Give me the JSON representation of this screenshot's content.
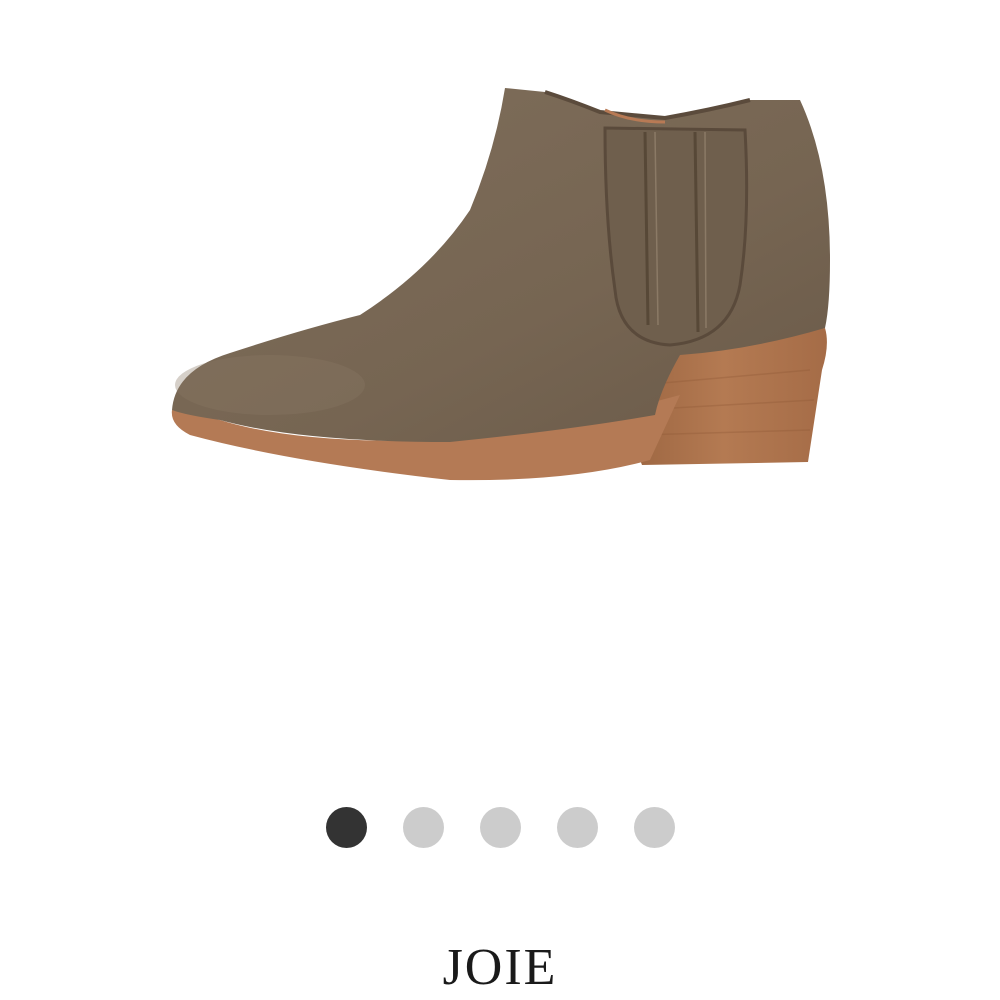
{
  "product": {
    "brand": "JOIE",
    "image_icon": "suede-ankle-boot-image"
  },
  "carousel": {
    "total": 5,
    "active_index": 0,
    "active_color": "#333333",
    "inactive_color": "#cccccc"
  },
  "colors": {
    "suede": "#7d6c5a",
    "leather_sole": "#b07a55",
    "background": "#ffffff"
  }
}
